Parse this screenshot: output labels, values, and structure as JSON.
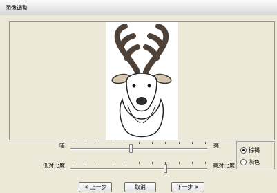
{
  "window": {
    "title": "图像调整"
  },
  "preview": {
    "image_icon": "reindeer-head-icon"
  },
  "brightness": {
    "min_label": "暗",
    "max_label": "亮",
    "value": 0.44,
    "tick_count": 11
  },
  "contrast": {
    "min_label": "低对比度",
    "max_label": "高对比度",
    "value": 0.7,
    "tick_count": 11
  },
  "mode": {
    "options": [
      {
        "label": "棕褐",
        "selected": true
      },
      {
        "label": "灰色",
        "selected": false
      }
    ]
  },
  "buttons": {
    "prev": "< 上一步",
    "cancel": "取消",
    "next": "下一步 >"
  }
}
